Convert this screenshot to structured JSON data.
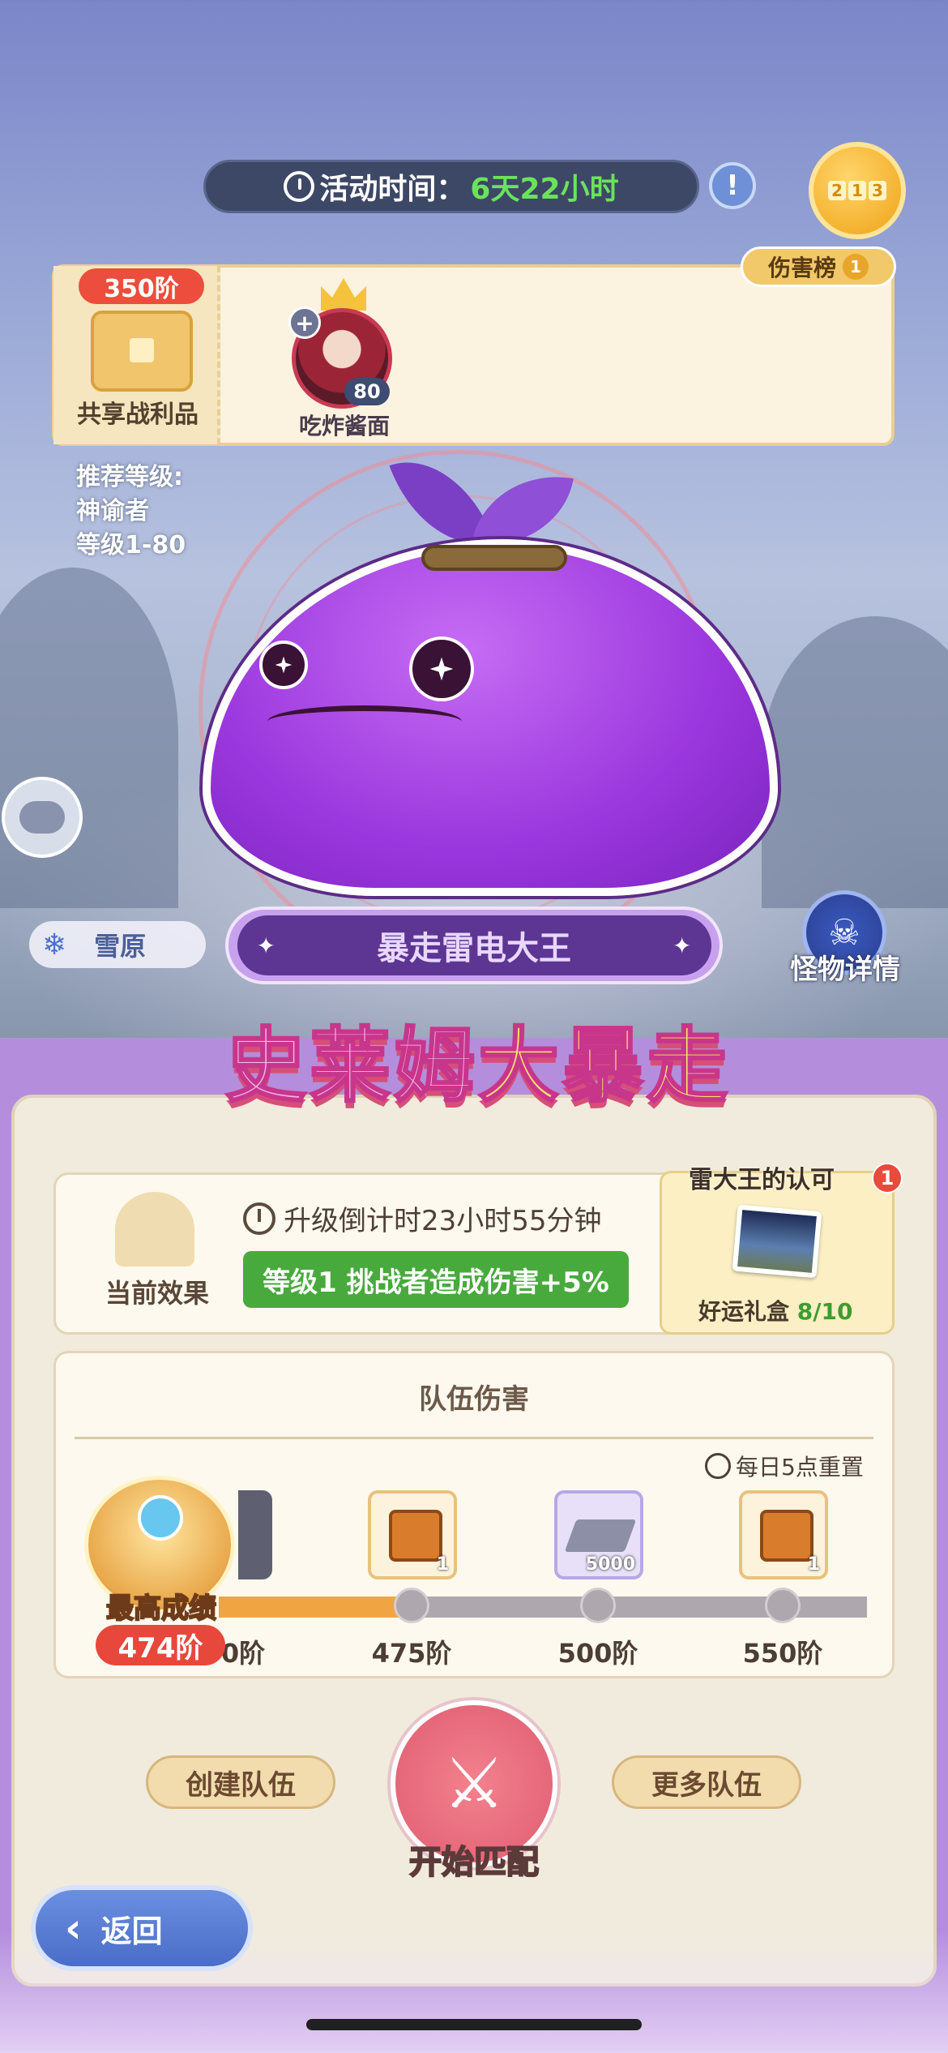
{
  "activity": {
    "time_label": "活动时间：",
    "time_value": "6天22小时"
  },
  "notice_icon": "exclamation-book-icon",
  "ranking": {
    "digits": [
      "2",
      "1",
      "3"
    ],
    "damage_tab_label": "伤害榜",
    "damage_tab_badge": "1"
  },
  "loot": {
    "tier": "350阶",
    "label": "共享战利品"
  },
  "player": {
    "name": "吃炸酱面",
    "level": "80",
    "add_icon": "+"
  },
  "recommend": {
    "line1": "推荐等级:",
    "line2": "神谕者",
    "line3": "等级1-80"
  },
  "boss": {
    "region_icon": "❄",
    "region": "雪原",
    "name": "暴走雷电大王",
    "spark_left": "✦",
    "spark_right": "✦",
    "detail_label": "怪物详情",
    "detail_icon": "monster-head-icon"
  },
  "event_title": {
    "part1": "史莱姆",
    "part2": "大暴走"
  },
  "effect": {
    "label": "当前效果",
    "countdown": "升级倒计时23小时55分钟",
    "buff": "等级1  挑战者造成伤害+5%"
  },
  "gift": {
    "title": "雷大王的认可",
    "badge": "1",
    "label": "好运礼盒",
    "progress": "8/10"
  },
  "team": {
    "title": "队伍伤害",
    "reset": "每日5点重置",
    "best_label": "最高成绩",
    "best_tier": "474阶",
    "progress_fraction": 0.3,
    "milestones": [
      {
        "tier": "0阶",
        "reward": "",
        "qty": ""
      },
      {
        "tier": "475阶",
        "reward": "chest",
        "qty": "1"
      },
      {
        "tier": "500阶",
        "reward": "ingot",
        "qty": "5000"
      },
      {
        "tier": "550阶",
        "reward": "chest",
        "qty": "1"
      }
    ]
  },
  "buttons": {
    "create": "创建队伍",
    "more": "更多队伍",
    "match": "开始匹配",
    "back": "返回",
    "back_arrow": "‹",
    "match_icon": "⚔"
  },
  "colors": {
    "accent_green": "#69e35c",
    "badge_red": "#ec4d3c",
    "buff_green": "#48aa3c",
    "progress_orange": "#f1a542"
  }
}
